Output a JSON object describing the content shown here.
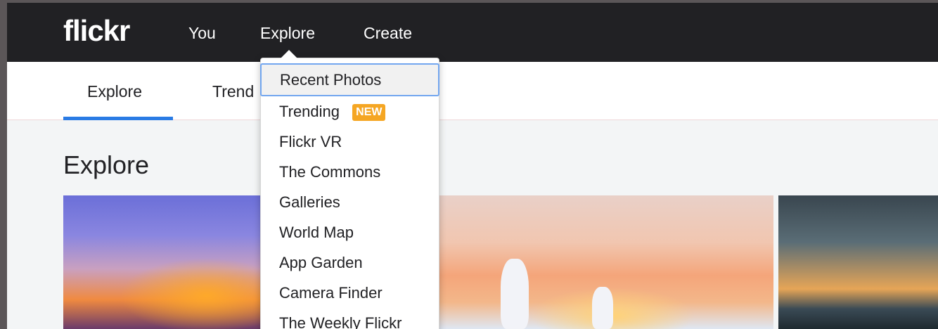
{
  "brand": {
    "logo": "flickr"
  },
  "topnav": {
    "you": "You",
    "explore": "Explore",
    "create": "Create"
  },
  "subnav": {
    "explore": "Explore",
    "trending_partial": "Trend"
  },
  "page": {
    "title": "Explore"
  },
  "dropdown": {
    "items": [
      {
        "label": "Recent Photos"
      },
      {
        "label": "Trending",
        "badge": "NEW"
      },
      {
        "label": "Flickr VR"
      },
      {
        "label": "The Commons"
      },
      {
        "label": "Galleries"
      },
      {
        "label": "World Map"
      },
      {
        "label": "App Garden"
      },
      {
        "label": "Camera Finder"
      },
      {
        "label": "The Weekly Flickr"
      }
    ]
  },
  "colors": {
    "topbar": "#212124",
    "accent_blue": "#2a7be4",
    "badge_orange": "#f5a623"
  }
}
